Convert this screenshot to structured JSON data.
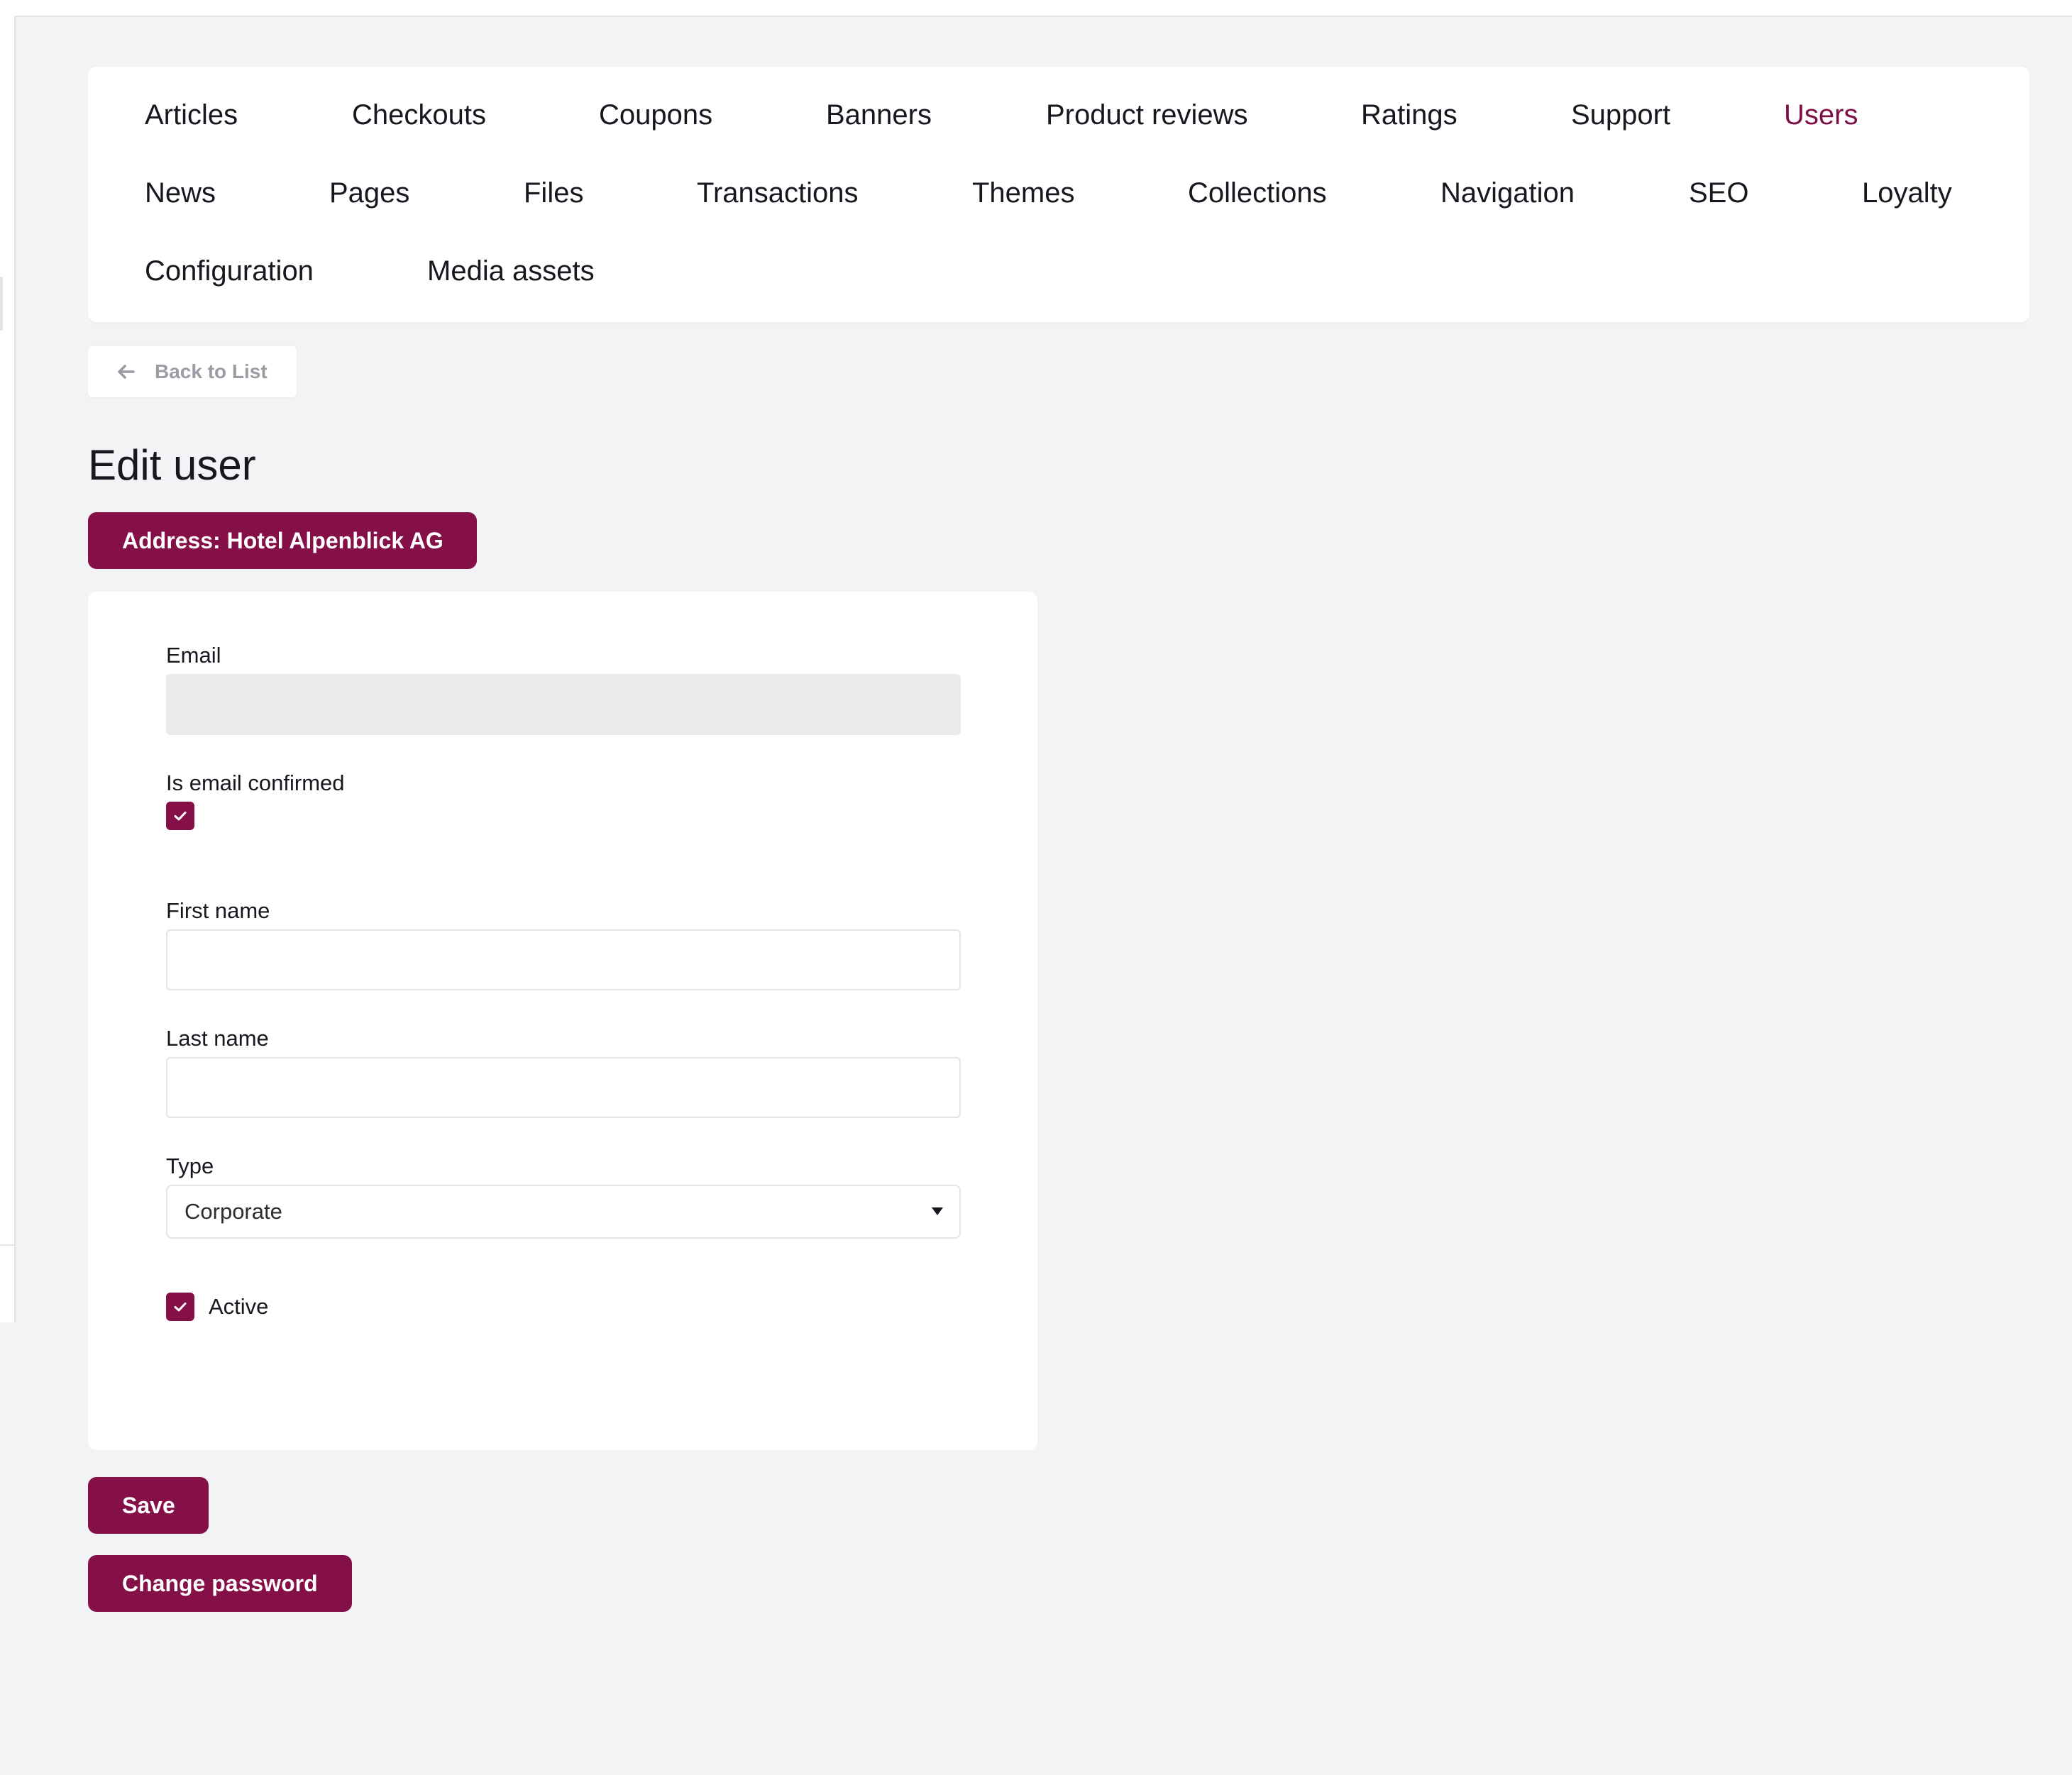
{
  "nav": {
    "items": [
      {
        "label": "Articles"
      },
      {
        "label": "Checkouts"
      },
      {
        "label": "Coupons"
      },
      {
        "label": "Banners"
      },
      {
        "label": "Product reviews"
      },
      {
        "label": "Ratings"
      },
      {
        "label": "Support"
      },
      {
        "label": "Users",
        "active": true
      },
      {
        "label": "News"
      },
      {
        "label": "Pages"
      },
      {
        "label": "Files"
      },
      {
        "label": "Transactions"
      },
      {
        "label": "Themes"
      },
      {
        "label": "Collections"
      },
      {
        "label": "Navigation"
      },
      {
        "label": "SEO"
      },
      {
        "label": "Loyalty"
      },
      {
        "label": "Configuration"
      },
      {
        "label": "Media assets"
      }
    ]
  },
  "back_button": {
    "label": "Back to List",
    "icon": "arrow-left-icon"
  },
  "page": {
    "title": "Edit user"
  },
  "address_button": {
    "label": "Address: Hotel Alpenblick AG"
  },
  "form": {
    "email": {
      "label": "Email",
      "value": ""
    },
    "email_confirmed": {
      "label": "Is email confirmed",
      "checked": true
    },
    "first_name": {
      "label": "First name",
      "value": ""
    },
    "last_name": {
      "label": "Last name",
      "value": ""
    },
    "type": {
      "label": "Type",
      "selected": "Corporate"
    },
    "active": {
      "label": "Active",
      "checked": true
    }
  },
  "actions": {
    "save_label": "Save",
    "change_password_label": "Change password"
  },
  "colors": {
    "accent": "#850f47",
    "active_nav": "#7c0f45",
    "background": "#f2f3f5"
  }
}
